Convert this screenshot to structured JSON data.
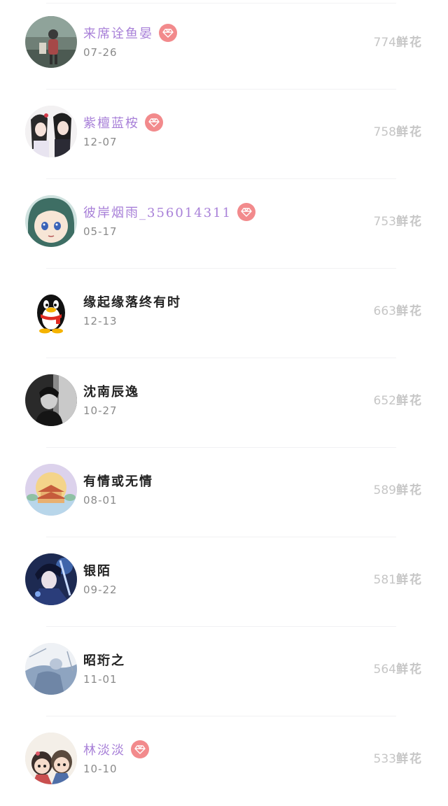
{
  "rows": [
    {
      "name": "来席诠鱼晏",
      "date": "07-26",
      "count": "774",
      "unit": "鲜花",
      "vip": true,
      "avatar": "photo-person-icon"
    },
    {
      "name": "紫檀蓝桉",
      "date": "12-07",
      "count": "758",
      "unit": "鲜花",
      "vip": true,
      "avatar": "anime-couple-icon"
    },
    {
      "name": "彼岸烟雨_356014311",
      "date": "05-17",
      "count": "753",
      "unit": "鲜花",
      "vip": true,
      "avatar": "anime-girl-icon"
    },
    {
      "name": "缘起缘落终有时",
      "date": "12-13",
      "count": "663",
      "unit": "鲜花",
      "vip": false,
      "avatar": "qq-penguin-icon"
    },
    {
      "name": "沈南辰逸",
      "date": "10-27",
      "count": "652",
      "unit": "鲜花",
      "vip": false,
      "avatar": "monochrome-photo-icon"
    },
    {
      "name": "有情或无情",
      "date": "08-01",
      "count": "589",
      "unit": "鲜花",
      "vip": false,
      "avatar": "pagoda-illustration-icon"
    },
    {
      "name": "银陌",
      "date": "09-22",
      "count": "581",
      "unit": "鲜花",
      "vip": false,
      "avatar": "anime-swordsman-icon"
    },
    {
      "name": "昭珩之",
      "date": "11-01",
      "count": "564",
      "unit": "鲜花",
      "vip": false,
      "avatar": "sketch-figure-icon"
    },
    {
      "name": "林淡淡",
      "date": "10-10",
      "count": "533",
      "unit": "鲜花",
      "vip": true,
      "avatar": "chibi-couple-icon"
    }
  ],
  "colors": {
    "vip_name": "#a880d8",
    "vip_badge": "#f28a8c",
    "normal_name": "#222222",
    "date": "#8a8a8a",
    "count": "#c6c6c6",
    "divider": "#f1f1f3"
  }
}
